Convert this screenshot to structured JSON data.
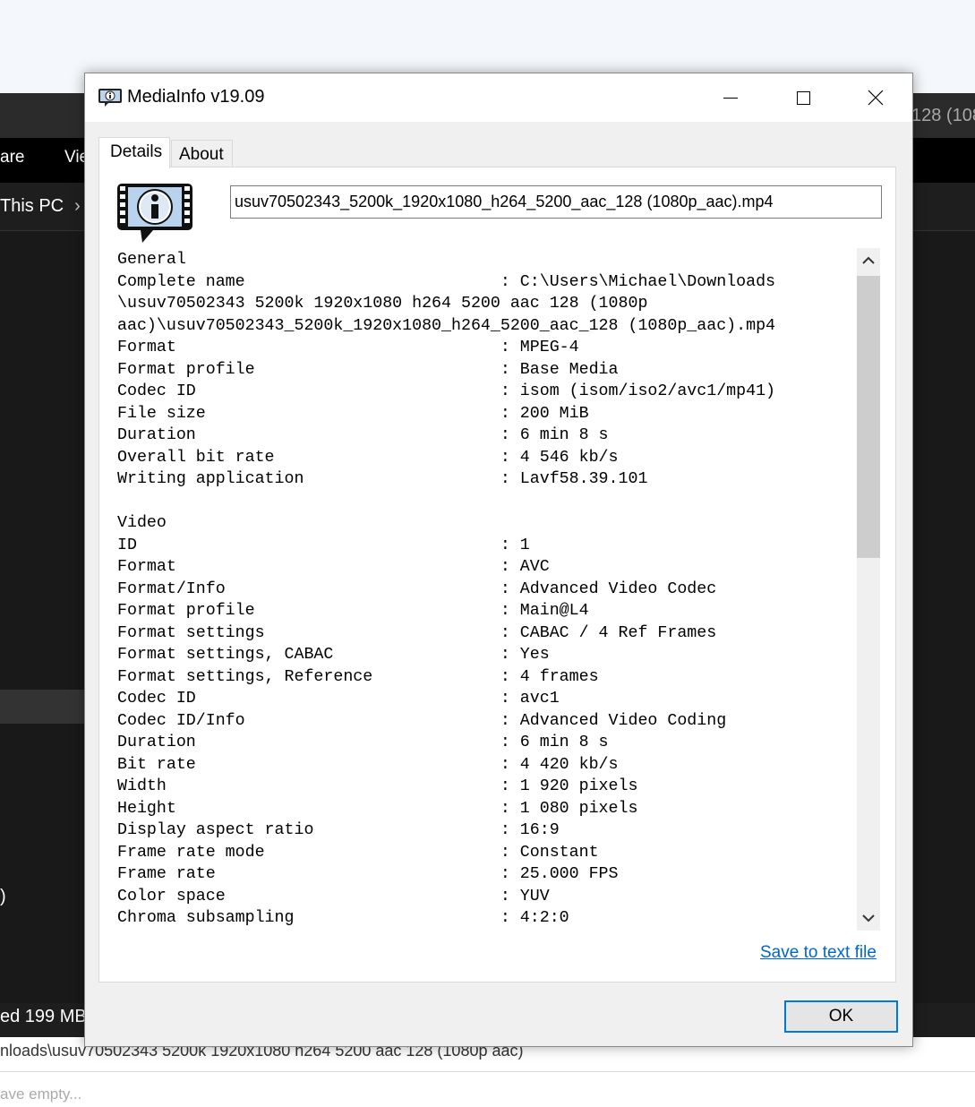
{
  "background_window": {
    "title_fragment": "128 (108",
    "menu_items": [
      "are",
      "Vie"
    ],
    "address_text": "This PC",
    "address_chevron": "›",
    "paren_fragment": ")",
    "status_text": "ed  199 MB",
    "path_text": "nloads\\usuv70502343 5200k 1920x1080 h264 5200 aac 128 (1080p aac)",
    "empty_text": "ave empty..."
  },
  "dialog": {
    "title": "MediaInfo v19.09",
    "tabs": [
      {
        "label": "Details",
        "active": true
      },
      {
        "label": "About",
        "active": false
      }
    ],
    "file_name": "usuv70502343_5200k_1920x1080_h264_5200_aac_128 (1080p_aac).mp4",
    "report_lines": [
      "General",
      "Complete name                          : C:\\Users\\Michael\\Downloads",
      "\\usuv70502343 5200k 1920x1080 h264 5200 aac 128 (1080p",
      "aac)\\usuv70502343_5200k_1920x1080_h264_5200_aac_128 (1080p_aac).mp4",
      "Format                                 : MPEG-4",
      "Format profile                         : Base Media",
      "Codec ID                               : isom (isom/iso2/avc1/mp41)",
      "File size                              : 200 MiB",
      "Duration                               : 6 min 8 s",
      "Overall bit rate                       : 4 546 kb/s",
      "Writing application                    : Lavf58.39.101",
      "",
      "Video",
      "ID                                     : 1",
      "Format                                 : AVC",
      "Format/Info                            : Advanced Video Codec",
      "Format profile                         : Main@L4",
      "Format settings                        : CABAC / 4 Ref Frames",
      "Format settings, CABAC                 : Yes",
      "Format settings, Reference             : 4 frames",
      "Codec ID                               : avc1",
      "Codec ID/Info                          : Advanced Video Coding",
      "Duration                               : 6 min 8 s",
      "Bit rate                               : 4 420 kb/s",
      "Width                                  : 1 920 pixels",
      "Height                                 : 1 080 pixels",
      "Display aspect ratio                   : 16:9",
      "Frame rate mode                        : Constant",
      "Frame rate                             : 25.000 FPS",
      "Color space                            : YUV",
      "Chroma subsampling                     : 4:2:0"
    ],
    "save_link": "Save to text file",
    "ok_label": "OK"
  },
  "colors": {
    "accent": "#0078d7",
    "link": "#0066cc",
    "dark_bg": "#191919"
  },
  "icons": {
    "app": "mediainfo-icon",
    "minimize": "minimize-icon",
    "maximize": "maximize-icon",
    "close": "close-icon",
    "scroll_up": "chevron-up-icon",
    "scroll_down": "chevron-down-icon"
  }
}
